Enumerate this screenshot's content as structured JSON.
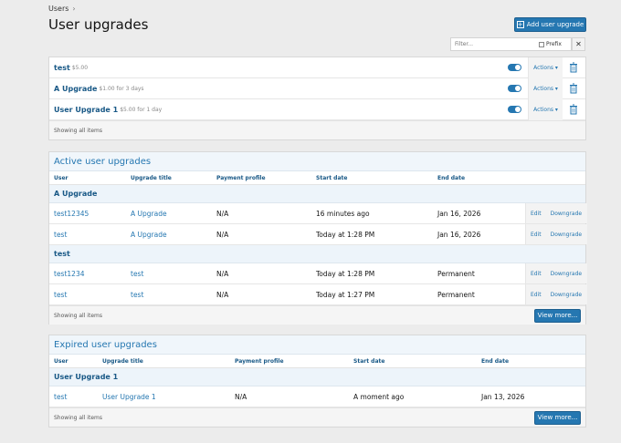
{
  "breadcrumb": {
    "items": [
      "Users"
    ]
  },
  "page_title": "User upgrades",
  "add_button": "Add user upgrade",
  "filter": {
    "placeholder": "Filter...",
    "prefix_label": "Prefix",
    "clear_glyph": "✕"
  },
  "upgrades": [
    {
      "name": "test",
      "cost": "$5.00"
    },
    {
      "name": "A Upgrade",
      "cost": "$1.00 for 3 days"
    },
    {
      "name": "User Upgrade 1",
      "cost": "$5.00 for 1 day"
    }
  ],
  "actions_label": "Actions ▾",
  "showing_all": "Showing all items",
  "active": {
    "title": "Active user upgrades",
    "headers": [
      "User",
      "Upgrade title",
      "Payment profile",
      "Start date",
      "End date"
    ],
    "groups": [
      {
        "name": "A Upgrade",
        "rows": [
          {
            "user": "test12345",
            "title": "A Upgrade",
            "payment": "N/A",
            "start": "16 minutes ago",
            "end": "Jan 16, 2026"
          },
          {
            "user": "test",
            "title": "A Upgrade",
            "payment": "N/A",
            "start": "Today at 1:28 PM",
            "end": "Jan 16, 2026"
          }
        ]
      },
      {
        "name": "test",
        "rows": [
          {
            "user": "test1234",
            "title": "test",
            "payment": "N/A",
            "start": "Today at 1:28 PM",
            "end": "Permanent"
          },
          {
            "user": "test",
            "title": "test",
            "payment": "N/A",
            "start": "Today at 1:27 PM",
            "end": "Permanent"
          }
        ]
      }
    ],
    "edit_label": "Edit",
    "downgrade_label": "Downgrade",
    "showing_all": "Showing all items",
    "view_more": "View more..."
  },
  "expired": {
    "title": "Expired user upgrades",
    "headers": [
      "User",
      "Upgrade title",
      "Payment profile",
      "Start date",
      "End date"
    ],
    "groups": [
      {
        "name": "User Upgrade 1",
        "rows": [
          {
            "user": "test",
            "title": "User Upgrade 1",
            "payment": "N/A",
            "start": "A moment ago",
            "end": "Jan 13, 2026"
          }
        ]
      }
    ],
    "showing_all": "Showing all items",
    "view_more": "View more..."
  },
  "colors": {
    "accent": "#2577b1",
    "link": "#185886",
    "section_bg": "#f0f6fb"
  }
}
